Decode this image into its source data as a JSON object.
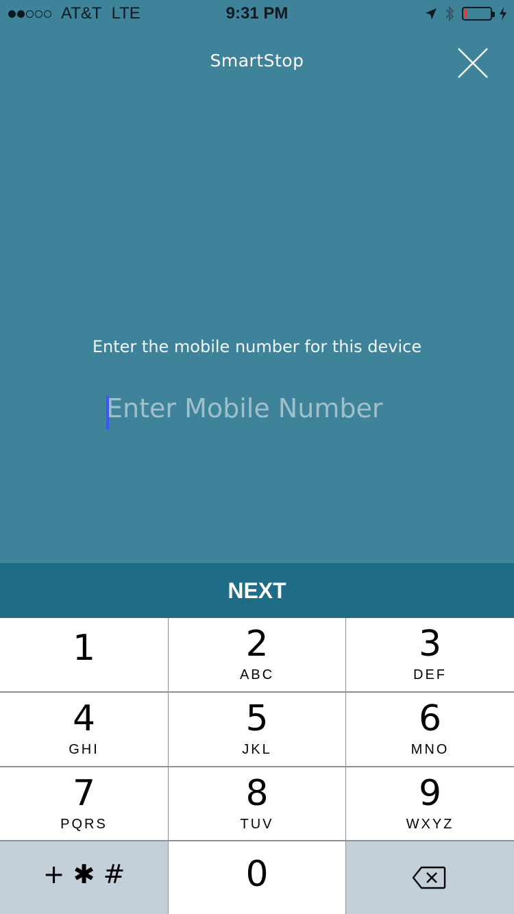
{
  "status": {
    "carrier": "AT&T",
    "network": "LTE",
    "time": "9:31 PM",
    "signal_bars_filled": 2,
    "signal_bars_total": 5,
    "battery_level": 0.1,
    "battery_color": "#e53a2d"
  },
  "header": {
    "brand": "SmartStop",
    "close_icon": "close-icon"
  },
  "form": {
    "prompt": "Enter the mobile number for this device",
    "mobile_placeholder": "Enter Mobile Number",
    "mobile_value": ""
  },
  "action": {
    "next_label": "NEXT"
  },
  "keypad": {
    "keys": [
      {
        "digit": "1",
        "letters": ""
      },
      {
        "digit": "2",
        "letters": "ABC"
      },
      {
        "digit": "3",
        "letters": "DEF"
      },
      {
        "digit": "4",
        "letters": "GHI"
      },
      {
        "digit": "5",
        "letters": "JKL"
      },
      {
        "digit": "6",
        "letters": "MNO"
      },
      {
        "digit": "7",
        "letters": "PQRS"
      },
      {
        "digit": "8",
        "letters": "TUV"
      },
      {
        "digit": "9",
        "letters": "WXYZ"
      },
      {
        "digit": "0",
        "letters": ""
      }
    ],
    "symbols_label": "+ ✱ #",
    "delete_icon": "backspace-icon"
  },
  "colors": {
    "background": "#3E8399",
    "next_bar": "#1F6C87",
    "keypad_dark_key": "#C3D0DA",
    "caret": "#3b55ff"
  }
}
